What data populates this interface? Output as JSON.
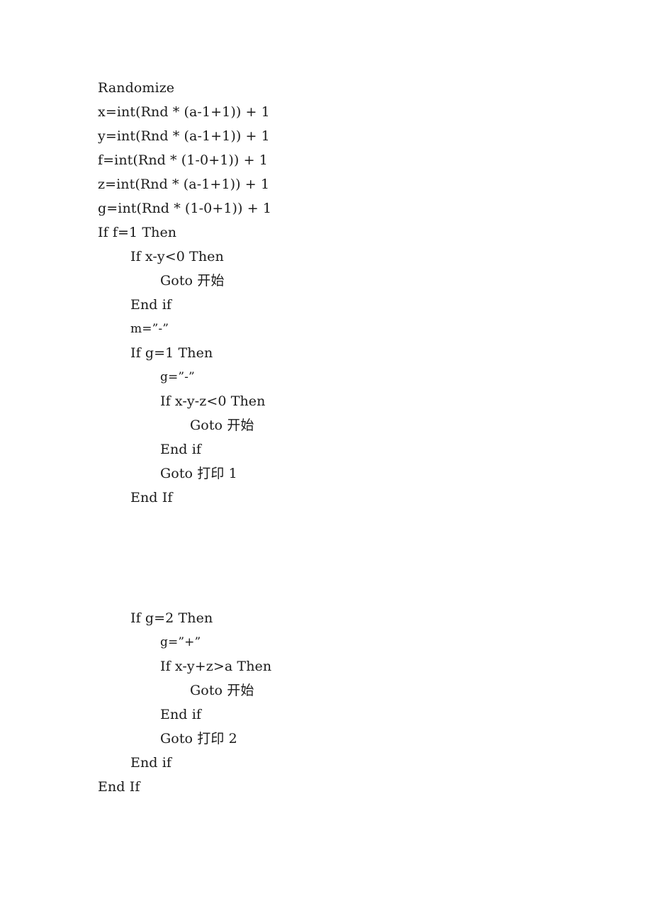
{
  "document": {
    "type": "printed-code-listing",
    "language_label": "Visual Basic",
    "background_color": "#ffffff",
    "text_color": "#1a1a1a",
    "lines": [
      {
        "indent": 0,
        "text": "Randomize"
      },
      {
        "indent": 0,
        "text": "x=int(Rnd * (a-1+1)) + 1"
      },
      {
        "indent": 0,
        "text": "y=int(Rnd * (a-1+1)) + 1"
      },
      {
        "indent": 0,
        "text": "f=int(Rnd * (1-0+1)) + 1"
      },
      {
        "indent": 0,
        "text": "z=int(Rnd * (a-1+1)) + 1"
      },
      {
        "indent": 0,
        "text": "g=int(Rnd * (1-0+1)) + 1"
      },
      {
        "indent": 0,
        "text": "If f=1 Then"
      },
      {
        "indent": 1,
        "text": "If x-y<0 Then"
      },
      {
        "indent": 2,
        "text": "Goto 开始"
      },
      {
        "indent": 1,
        "text": "End if"
      },
      {
        "indent": 1,
        "text": "m=”-”",
        "small": true
      },
      {
        "indent": 1,
        "text": "If g=1 Then"
      },
      {
        "indent": 2,
        "text": "g=”-”",
        "small": true
      },
      {
        "indent": 2,
        "text": "If x-y-z<0 Then"
      },
      {
        "indent": 3,
        "text": "Goto 开始"
      },
      {
        "indent": 2,
        "text": "End if"
      },
      {
        "indent": 2,
        "text": "Goto 打印 1"
      },
      {
        "indent": 1,
        "text": "End If"
      },
      {
        "indent": 0,
        "text": "",
        "blank": true
      },
      {
        "indent": 0,
        "text": "",
        "blank": true
      },
      {
        "indent": 0,
        "text": "",
        "blank": true
      },
      {
        "indent": 0,
        "text": "",
        "blank": true
      },
      {
        "indent": 1,
        "text": "If g=2 Then"
      },
      {
        "indent": 2,
        "text": "g=”+”",
        "small": true
      },
      {
        "indent": 2,
        "text": "If x-y+z>a Then"
      },
      {
        "indent": 3,
        "text": "Goto 开始"
      },
      {
        "indent": 2,
        "text": "End if"
      },
      {
        "indent": 2,
        "text": "Goto 打印 2"
      },
      {
        "indent": 1,
        "text": "End if"
      },
      {
        "indent": 0,
        "text": "End If"
      }
    ]
  }
}
